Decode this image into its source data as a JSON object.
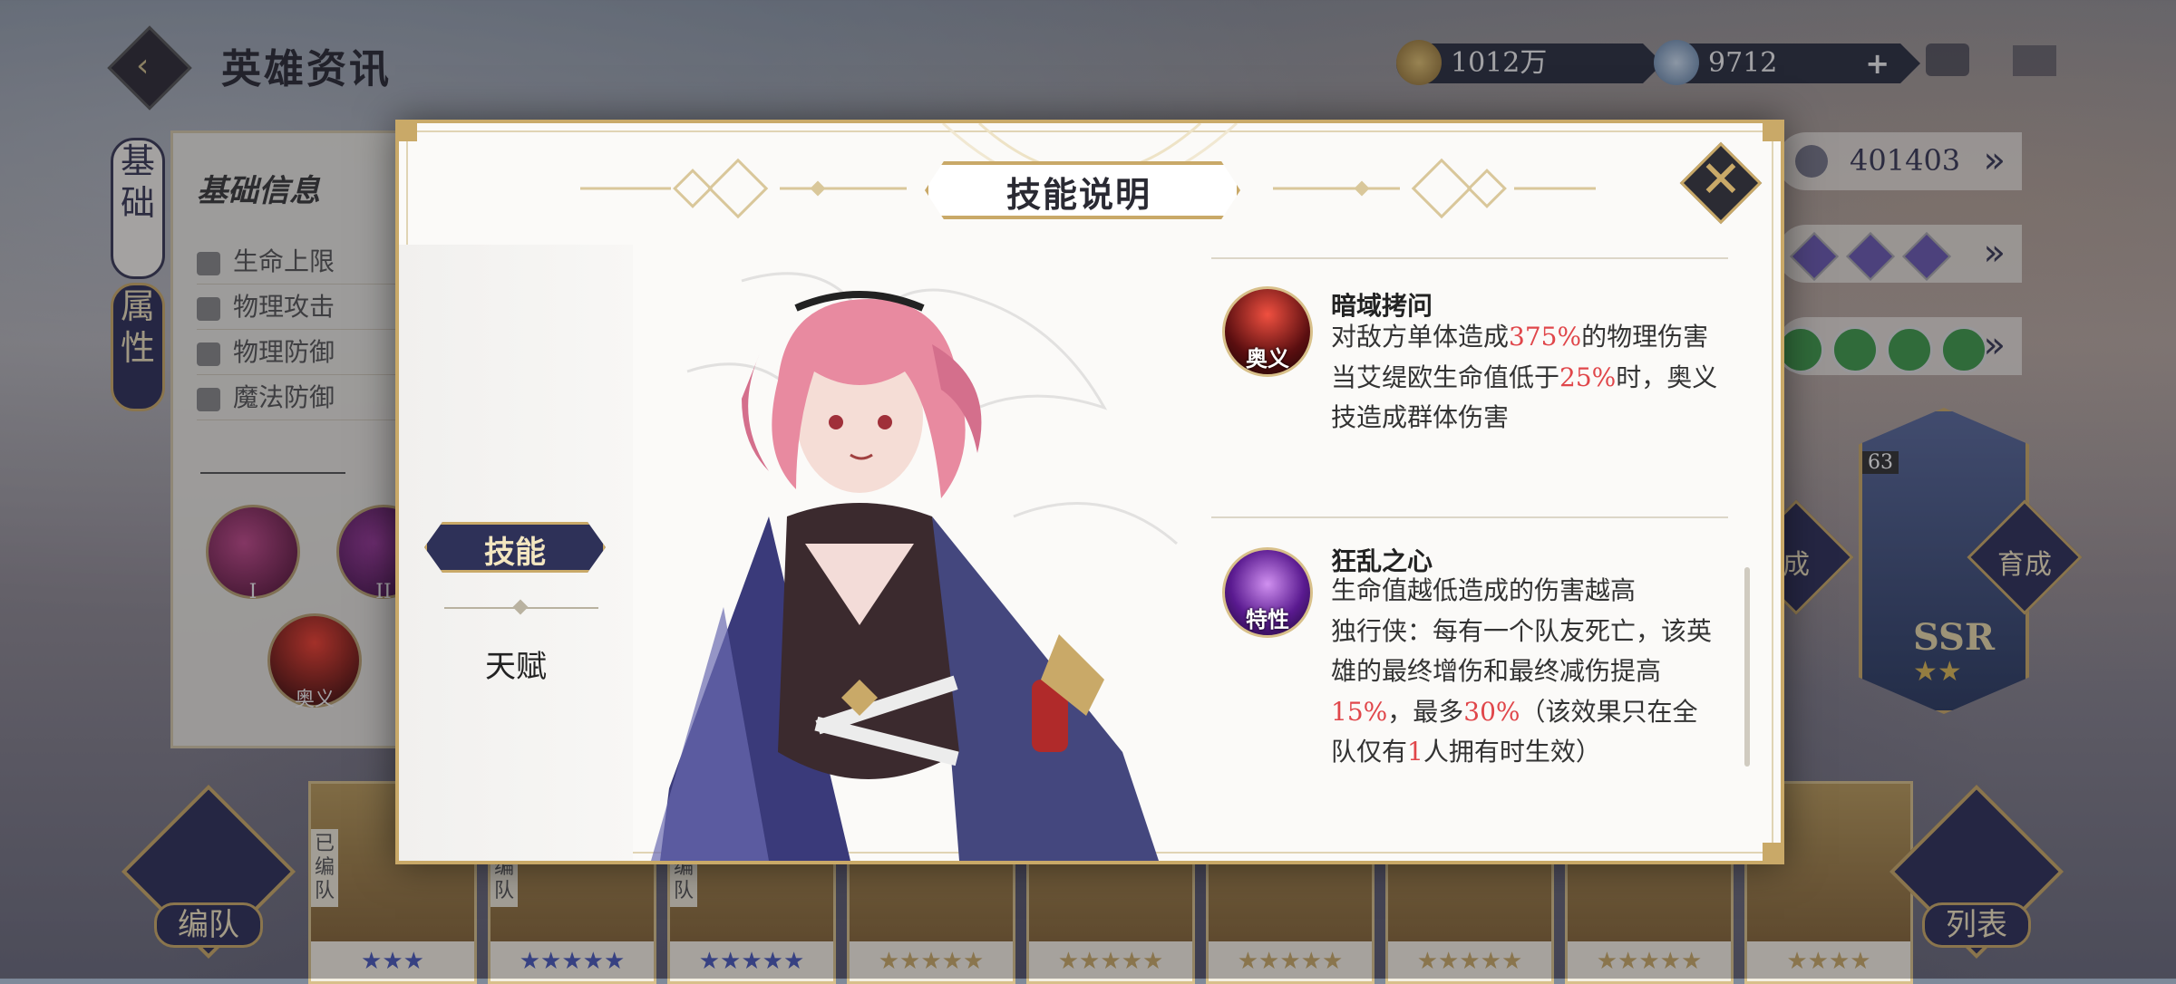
{
  "header": {
    "title": "英雄资讯",
    "gold": "1012万",
    "gems": "9712",
    "plus": "+"
  },
  "left_tabs": {
    "base": "基础",
    "attr": "属性"
  },
  "info_panel": {
    "title": "基础信息",
    "stats": [
      "生命上限",
      "物理攻击",
      "物理防御",
      "魔法防御"
    ],
    "skill_badges": [
      "I",
      "II",
      "奥义"
    ]
  },
  "right_panel": {
    "power": "401403"
  },
  "ssr_card": {
    "level": "63",
    "rarity": "SSR",
    "stars": "★★"
  },
  "buttons": {
    "cultivate_left": "成",
    "cultivate_right": "育成",
    "team": "编队",
    "list": "列表"
  },
  "roster": {
    "slots": [
      {
        "tag": "已编队",
        "stars": "★★★",
        "color": "blue"
      },
      {
        "tag": "已编队",
        "stars": "★★★★★",
        "color": "blue"
      },
      {
        "tag": "已编队",
        "stars": "★★★★★",
        "color": "blue"
      },
      {
        "tag": "",
        "stars": "★★★★★",
        "color": "gold"
      },
      {
        "tag": "",
        "stars": "★★★★★",
        "color": "gold"
      },
      {
        "tag": "",
        "stars": "★★★★★",
        "color": "gold"
      },
      {
        "tag": "",
        "stars": "★★★★★",
        "color": "gold"
      },
      {
        "tag": "",
        "stars": "★★★★★",
        "color": "gold"
      },
      {
        "tag": "",
        "stars": "★★★★",
        "color": "gold"
      }
    ]
  },
  "modal": {
    "title": "技能说明",
    "close": "✕",
    "nav_active": "技能",
    "nav_item": "天赋",
    "skills": [
      {
        "icon_label": "奥义",
        "name": "暗域拷问",
        "desc_parts": [
          {
            "t": "对敌方单体造成"
          },
          {
            "t": "375%",
            "hl": true
          },
          {
            "t": "的物理伤害"
          },
          {
            "br": true
          },
          {
            "t": "当艾缇欧生命值低于"
          },
          {
            "t": "25%",
            "hl": true
          },
          {
            "t": "时，奥义技造成群体伤害"
          }
        ]
      },
      {
        "icon_label": "特性",
        "name": "狂乱之心",
        "desc_parts": [
          {
            "t": "生命值越低造成的伤害越高"
          },
          {
            "br": true
          },
          {
            "t": "独行侠：每有一个队友死亡，该英雄的最终增伤和最终减伤提高"
          },
          {
            "t": "15%",
            "hl": true
          },
          {
            "t": "，最多"
          },
          {
            "t": "30%",
            "hl": true
          },
          {
            "t": "（该效果只在全队仅有"
          },
          {
            "t": "1",
            "hl": true
          },
          {
            "t": "人拥有时生效）"
          }
        ]
      }
    ]
  },
  "colors": {
    "accent_gold": "#c9a968",
    "navy": "#2e3158",
    "highlight": "#e0464a"
  }
}
